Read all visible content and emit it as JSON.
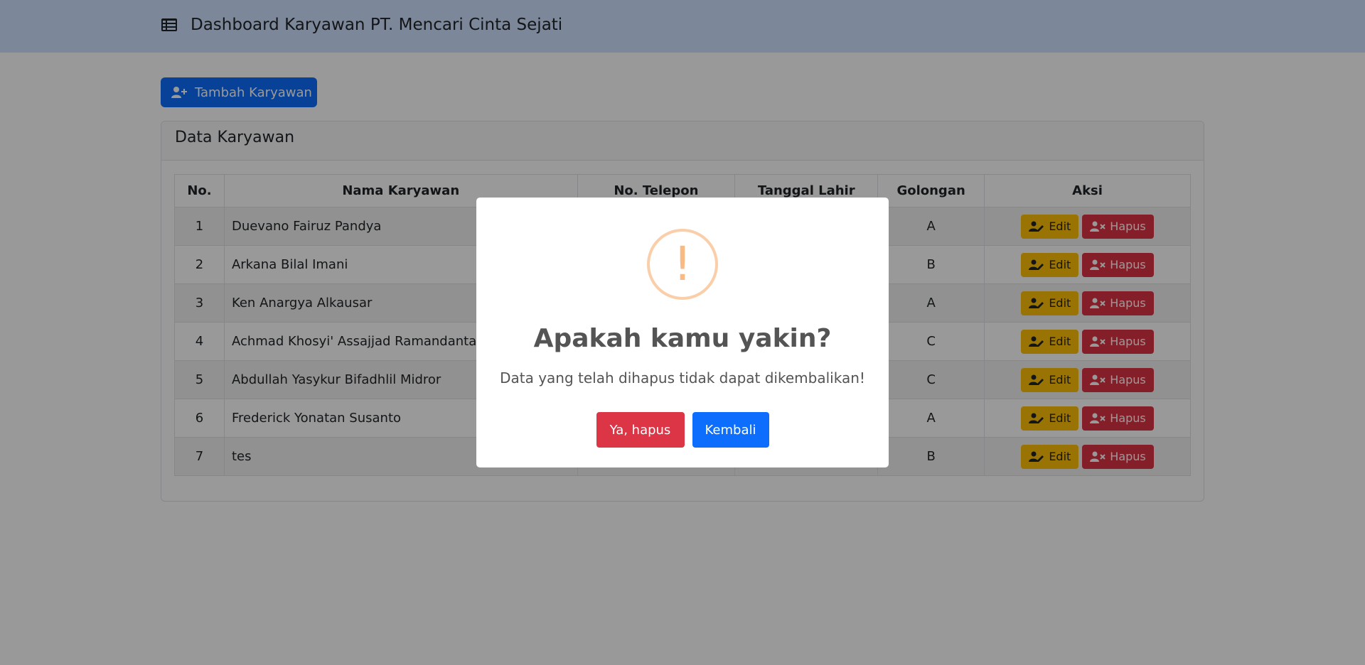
{
  "header": {
    "title": "Dashboard Karyawan PT. Mencari Cinta Sejati",
    "icon": "table-list-icon"
  },
  "toolbar": {
    "add_label": "Tambah Karyawan",
    "add_icon": "user-plus-icon"
  },
  "card": {
    "title": "Data Karyawan"
  },
  "table": {
    "columns": [
      "No.",
      "Nama Karyawan",
      "No. Telepon",
      "Tanggal Lahir",
      "Golongan",
      "Aksi"
    ],
    "rows": [
      {
        "no": "1",
        "name": "Duevano Fairuz Pandya",
        "golongan": "A"
      },
      {
        "no": "2",
        "name": "Arkana Bilal Imani",
        "golongan": "B"
      },
      {
        "no": "3",
        "name": "Ken Anargya Alkausar",
        "golongan": "A"
      },
      {
        "no": "4",
        "name": "Achmad Khosyi' Assajjad Ramandanta",
        "golongan": "C"
      },
      {
        "no": "5",
        "name": "Abdullah Yasykur Bifadhlil Midror",
        "golongan": "C"
      },
      {
        "no": "6",
        "name": "Frederick Yonatan Susanto",
        "golongan": "A"
      },
      {
        "no": "7",
        "name": "tes",
        "golongan": "B"
      }
    ],
    "edit_label": "Edit",
    "delete_label": "Hapus"
  },
  "dialog": {
    "icon": "!",
    "title": "Apakah kamu yakin?",
    "text": "Data yang telah dihapus tidak dapat dikembalikan!",
    "confirm_label": "Ya, hapus",
    "cancel_label": "Kembali"
  },
  "colors": {
    "primary": "#0d6efd",
    "danger": "#dc3545",
    "warning": "#ffc107",
    "header_bg": "#cfe2ff",
    "warn_icon": "#f8bb86"
  }
}
